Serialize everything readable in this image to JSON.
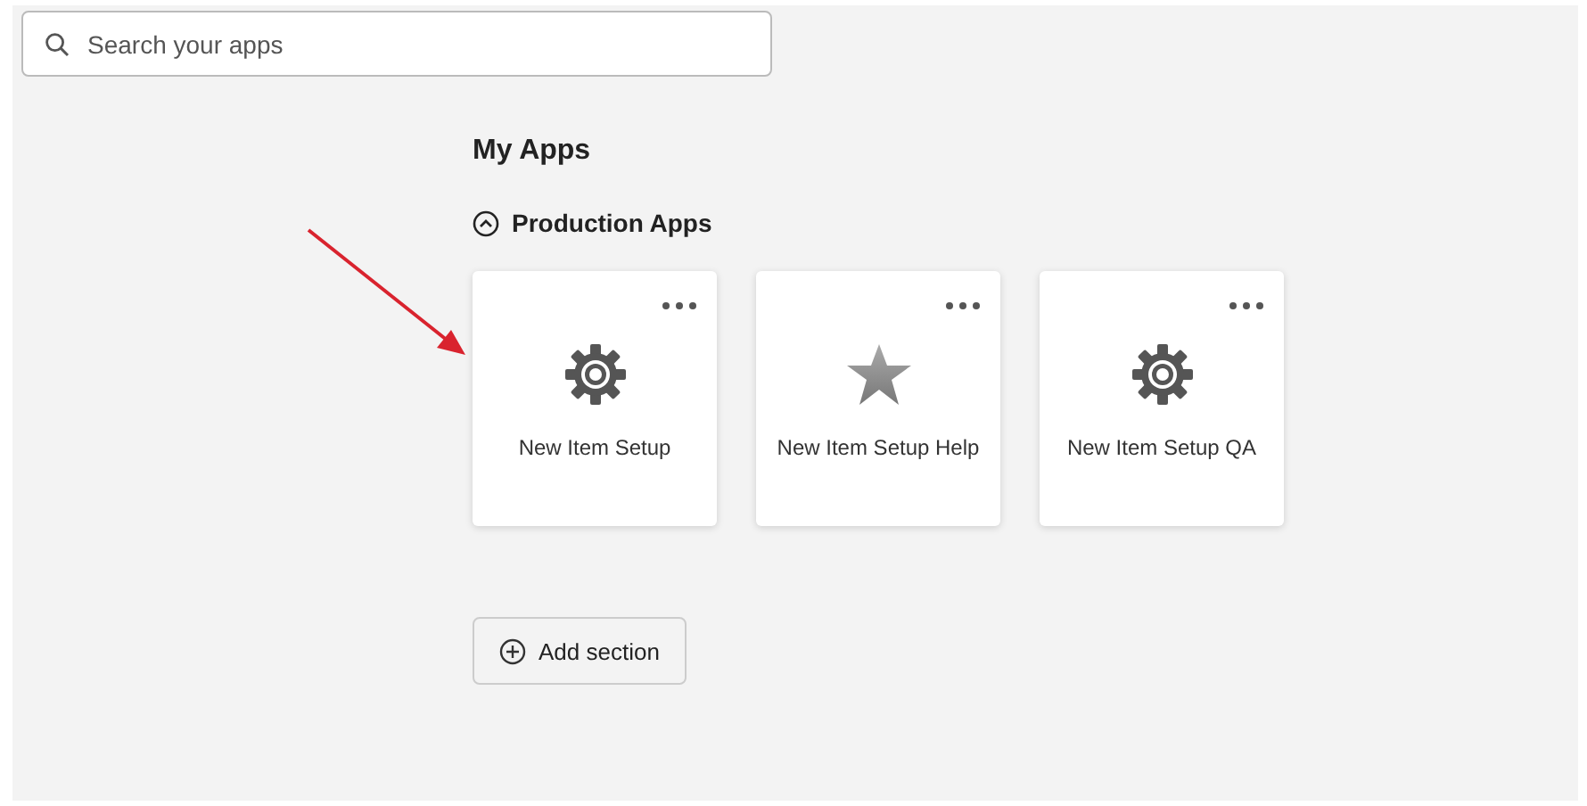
{
  "search": {
    "placeholder": "Search your apps"
  },
  "heading": "My Apps",
  "section": {
    "title": "Production Apps",
    "expanded": true,
    "apps": [
      {
        "name": "New Item Setup",
        "kind": "gear"
      },
      {
        "name": "New Item Setup Help",
        "kind": "star"
      },
      {
        "name": "New Item Setup QA",
        "kind": "gear"
      }
    ]
  },
  "add_button": "Add section"
}
